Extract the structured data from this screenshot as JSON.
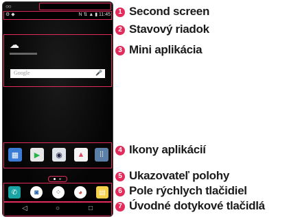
{
  "phone": {
    "statusbar": {
      "left_icons": "⚙ ◆",
      "right_icons": "N ⇅ ▲ ▮ 11:45"
    },
    "widget": {
      "search_label": "Google",
      "mic_icon": "microphone-icon",
      "weather_icon": "cloud-sun-icon"
    },
    "home_apps": [
      "calendar-app-icon",
      "play-store-icon",
      "camera-app-icon",
      "gallery-app-icon",
      "apps-folder-icon"
    ],
    "quick_apps": [
      "phone-app-icon",
      "contacts-app-icon",
      "apps-drawer-icon",
      "chrome-app-icon",
      "messaging-app-icon"
    ],
    "nav_buttons": [
      "back-button",
      "home-button",
      "recent-apps-button"
    ]
  },
  "callouts": [
    {
      "number": "1",
      "label": "Second screen"
    },
    {
      "number": "2",
      "label": "Stavový riadok"
    },
    {
      "number": "3",
      "label": "Mini aplikácia"
    },
    {
      "number": "4",
      "label": "Ikony aplikácií"
    },
    {
      "number": "5",
      "label": "Ukazovateľ polohy"
    },
    {
      "number": "6",
      "label": "Pole rýchlych tlačidiel"
    },
    {
      "number": "7",
      "label": "Úvodné dotykové tlačidlá"
    }
  ],
  "colors": {
    "accent": "#e32c5b"
  }
}
